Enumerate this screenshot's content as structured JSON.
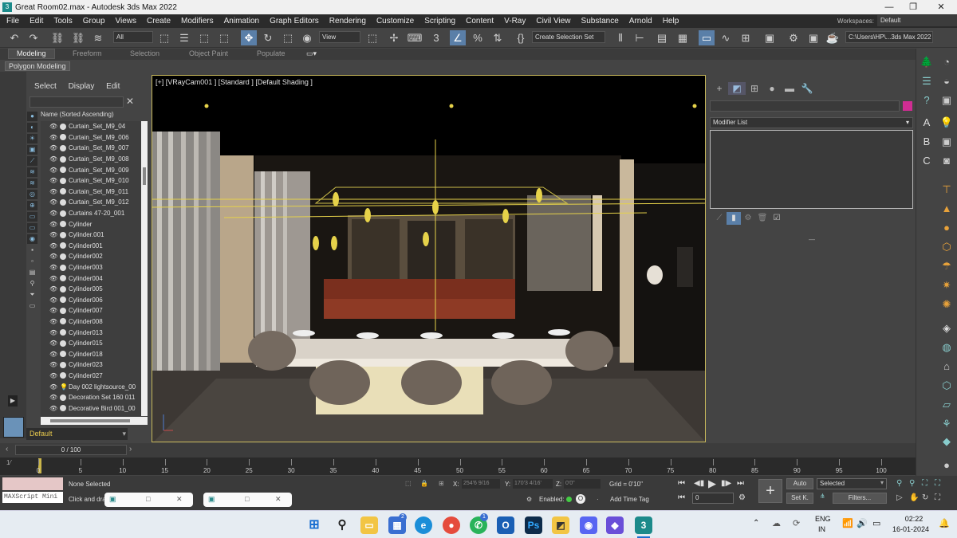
{
  "window": {
    "title": "Great Room02.max - Autodesk 3ds Max 2022",
    "minimize": "—",
    "maximize": "❐",
    "close": "✕"
  },
  "menu": {
    "items": [
      "File",
      "Edit",
      "Tools",
      "Group",
      "Views",
      "Create",
      "Modifiers",
      "Animation",
      "Graph Editors",
      "Rendering",
      "Customize",
      "Scripting",
      "Content",
      "V-Ray",
      "Civil View",
      "Substance",
      "Arnold",
      "Help"
    ],
    "workspaces_label": "Workspaces:",
    "workspaces_value": "Default"
  },
  "toolbar": {
    "filter_value": "All",
    "refcoord_value": "View",
    "selection_set": "Create Selection Set",
    "project_path": "C:\\Users\\HP\\...3ds Max 2022"
  },
  "ribbon": {
    "tabs": [
      "Modeling",
      "Freeform",
      "Selection",
      "Object Paint",
      "Populate"
    ],
    "active": "Modeling",
    "sub": "Polygon Modeling"
  },
  "scene_explorer": {
    "tabs": [
      "Select",
      "Display",
      "Edit"
    ],
    "column_header": "Name (Sorted Ascending)",
    "items": [
      "Curtain_Set_M9_04",
      "Curtain_Set_M9_006",
      "Curtain_Set_M9_007",
      "Curtain_Set_M9_008",
      "Curtain_Set_M9_009",
      "Curtain_Set_M9_010",
      "Curtain_Set_M9_011",
      "Curtain_Set_M9_012",
      "Curtains 47-20_001",
      "Cylinder",
      "Cylinder.001",
      "Cylinder001",
      "Cylinder002",
      "Cylinder003",
      "Cylinder004",
      "Cylinder005",
      "Cylinder006",
      "Cylinder007",
      "Cylinder008",
      "Cylinder013",
      "Cylinder015",
      "Cylinder018",
      "Cylinder023",
      "Cylinder027",
      "Day 002 lightsource_00",
      "Decoration Set 160 011",
      "Decorative Bird 001_00"
    ],
    "layer": "Default"
  },
  "viewport": {
    "label": "[+] [VRayCam001 ] [Standard ] [Default Shading ]"
  },
  "command_panel": {
    "modifier_list": "Modifier List",
    "swatch_color": "#d02d93"
  },
  "timeline": {
    "frame": "0 / 100",
    "ticks": [
      "0",
      "5",
      "10",
      "15",
      "20",
      "25",
      "30",
      "35",
      "40",
      "45",
      "50",
      "55",
      "60",
      "65",
      "70",
      "75",
      "80",
      "85",
      "90",
      "95",
      "100"
    ]
  },
  "status": {
    "maxscript": "MAXScript Mini",
    "none_selected": "None Selected",
    "prompt": "Click and drag",
    "x_label": "X:",
    "x_value": "254'6 9/16",
    "y_label": "Y:",
    "y_value": "170'3 4/16'",
    "z_label": "Z:",
    "z_value": "0'0\"",
    "grid": "Grid = 0'10\"",
    "enabled": "Enabled:",
    "add_time_tag": "Add Time Tag",
    "auto_key": "Auto",
    "set_key": "Set K.",
    "selected": "Selected",
    "filters": "Filters...",
    "frame_field": "0"
  },
  "taskbar": {
    "lang_top": "ENG",
    "lang_bottom": "IN",
    "time": "02:22",
    "date": "16-01-2024",
    "badges": {
      "store": "2",
      "whatsapp": "1"
    }
  }
}
